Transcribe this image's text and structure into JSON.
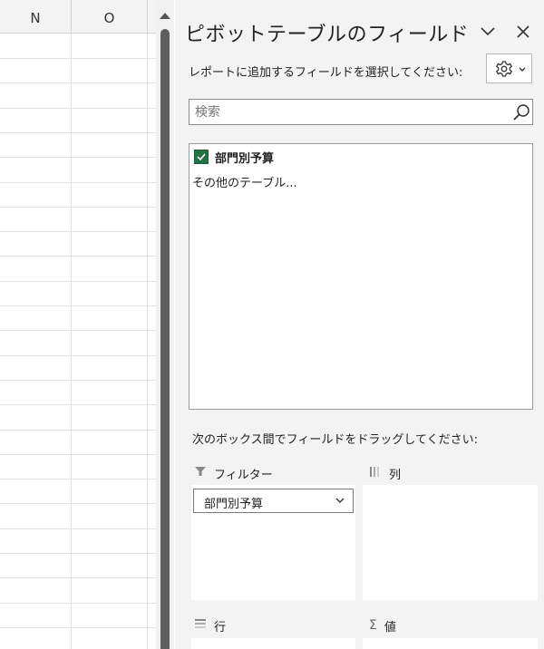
{
  "sheet": {
    "columns": [
      "N",
      "O"
    ]
  },
  "pane": {
    "title": "ピボットテーブルのフィールド",
    "choose_label": "レポートに追加するフィールドを選択してください:",
    "settings_icon": "gear-icon",
    "search": {
      "placeholder": "検索",
      "value": ""
    },
    "fields": [
      {
        "label": "部門別予算",
        "checked": true
      }
    ],
    "more_tables": "その他のテーブル...",
    "drag_label": "次のボックス間でフィールドをドラッグしてください:",
    "areas": {
      "filter": {
        "label": "フィルター",
        "items": [
          "部門別予算"
        ]
      },
      "columns": {
        "label": "列",
        "items": []
      },
      "rows": {
        "label": "行",
        "items": []
      },
      "values": {
        "label": "値",
        "items": []
      }
    }
  },
  "colors": {
    "accent": "#217346",
    "pane_background": "#f3f3f3"
  }
}
